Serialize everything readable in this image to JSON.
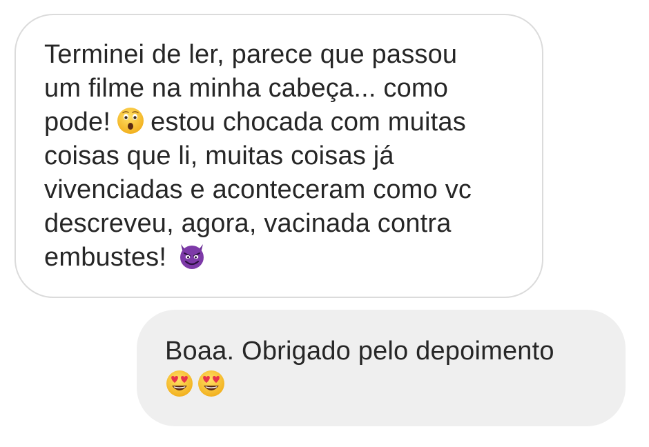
{
  "messages": {
    "received": {
      "lines": [
        "Terminei de ler, parece que passou",
        "um filme na minha cabeça... como",
        "pode!",
        "estou chocada com muitas",
        "coisas que li, muitas coisas já",
        "vivenciadas e aconteceram como vc",
        "descreveu, agora, vacinada contra",
        "embustes!"
      ],
      "emojis": [
        "hushed-face-emoji",
        "smiling-face-with-horns-emoji"
      ]
    },
    "sent": {
      "lines": [
        "Boaa. Obrigado pelo depoimento"
      ],
      "emojis": [
        "smiling-face-with-heart-eyes-emoji",
        "smiling-face-with-heart-eyes-emoji"
      ]
    }
  },
  "colors": {
    "text": "#262626",
    "received_border": "#dbdbdb",
    "sent_background": "#efefef",
    "emoji_yellow": "#f7c02a",
    "emoji_purple": "#7d3aa8",
    "emoji_heart": "#e8334a"
  }
}
